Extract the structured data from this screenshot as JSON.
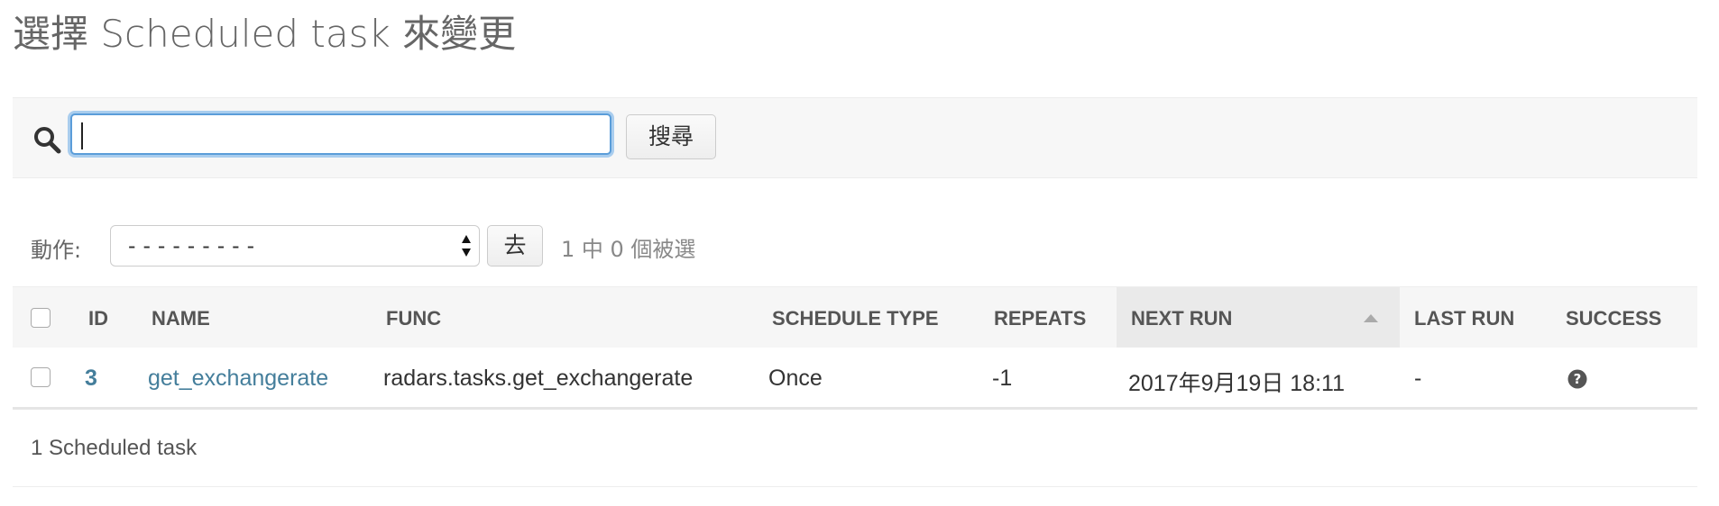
{
  "page": {
    "title": "選擇 Scheduled task 來變更"
  },
  "search": {
    "value": "",
    "button_label": "搜尋",
    "icon": "search-icon"
  },
  "actions": {
    "label": "動作:",
    "selected_option": "---------",
    "go_label": "去",
    "selection_count": "1 中 0 個被選"
  },
  "table": {
    "columns": [
      "ID",
      "NAME",
      "FUNC",
      "SCHEDULE TYPE",
      "REPEATS",
      "NEXT RUN",
      "LAST RUN",
      "SUCCESS"
    ],
    "sorted_column": "NEXT RUN",
    "rows": [
      {
        "id": "3",
        "name": "get_exchangerate",
        "func": "radars.tasks.get_exchangerate",
        "schedule_type": "Once",
        "repeats": "-1",
        "next_run": "2017年9月19日 18:11",
        "last_run": "-",
        "success_icon": "question-circle-icon"
      }
    ]
  },
  "footer": {
    "count_text": "1 Scheduled task"
  },
  "colors": {
    "link": "#447e9b",
    "focus": "#5b9dd9",
    "header_bg": "#f6f6f6"
  }
}
